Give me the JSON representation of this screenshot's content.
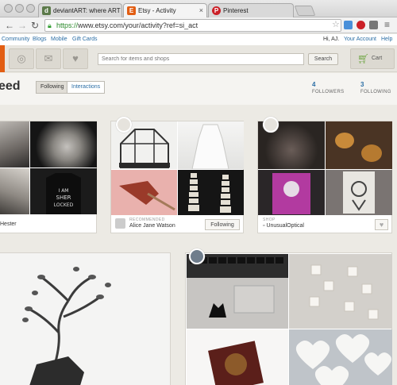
{
  "browser": {
    "tabs": [
      {
        "label": "deviantART: where ART m",
        "favicon_color": "#5c7a4a",
        "favicon_glyph": "d"
      },
      {
        "label": "Etsy - Activity",
        "favicon_color": "#e25e13",
        "favicon_glyph": "E"
      },
      {
        "label": "Pinterest",
        "favicon_color": "#cb2027",
        "favicon_glyph": "P"
      }
    ],
    "url_scheme": "https://",
    "url_rest": "www.etsy.com/your/activity?ref=si_act",
    "icons": [
      "back-icon",
      "forward-icon",
      "reload-icon",
      "lock-icon",
      "star-icon",
      "menu-icon"
    ]
  },
  "etsy": {
    "links": [
      "Community",
      "Blogs",
      "Mobile",
      "Gift Cards"
    ],
    "greeting": "Hi, AJ.",
    "your_account": "Your Account",
    "help": "Help",
    "search_placeholder": "Search for items and shops",
    "search_button": "Search",
    "cart_label": "Cart",
    "accent": "#e25e13"
  },
  "activity": {
    "title": "eed",
    "tabs": [
      "Following",
      "Interactions"
    ],
    "followers_count": "4",
    "followers_label": "FOLLOWERS",
    "following_count": "3",
    "following_label": "FOLLOWING"
  },
  "cards": [
    {
      "caption": "Hester"
    },
    {
      "meta": "RECOMMENDED",
      "caption": "Alice Jane Watson",
      "button": "Following"
    },
    {
      "meta": "SHOP",
      "caption": "UnusualOptical",
      "button": "♥"
    }
  ]
}
